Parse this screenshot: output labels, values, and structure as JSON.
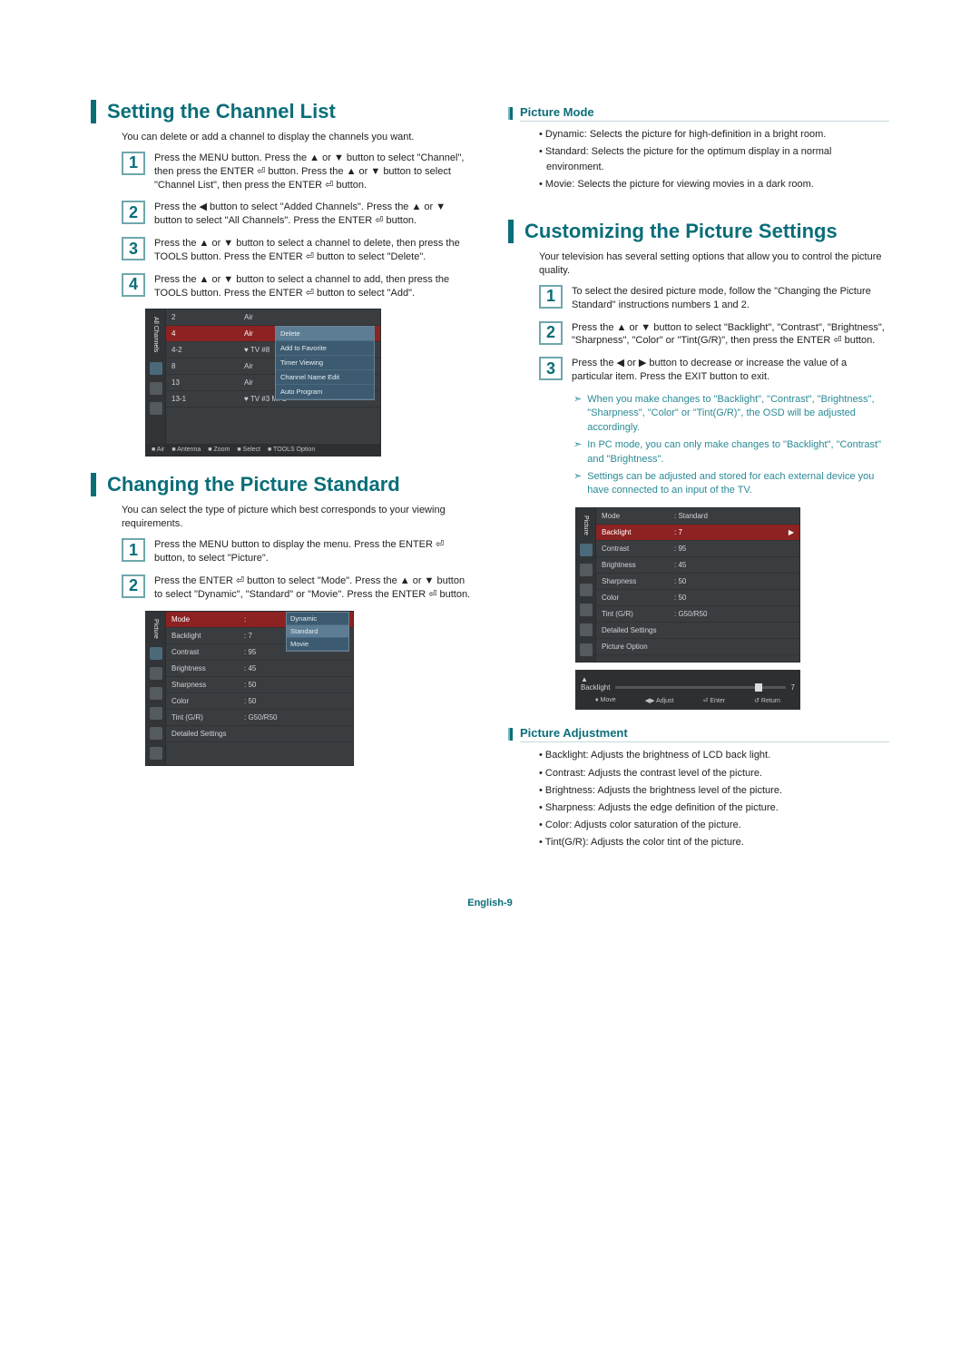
{
  "page_footer": "English-9",
  "left": {
    "section1": {
      "title": "Setting the Channel List",
      "intro": "You can delete or add a channel to display the channels you want.",
      "steps": [
        "Press the MENU button. Press the ▲ or ▼ button to select \"Channel\", then press the ENTER ⏎ button. Press the ▲ or ▼ button to select \"Channel List\", then press the ENTER ⏎ button.",
        "Press the ◀ button to select \"Added Channels\". Press the ▲ or ▼ button to select \"All Channels\". Press the ENTER ⏎ button.",
        "Press the ▲ or ▼ button to select a channel to delete, then press the TOOLS button. Press the ENTER ⏎ button to select \"Delete\".",
        "Press the ▲ or ▼ button to select a channel to add, then press the TOOLS button. Press the ENTER ⏎ button to select \"Add\"."
      ],
      "osd": {
        "side_label": "All Channels",
        "rows": [
          {
            "c1": "2",
            "c2": "Air"
          },
          {
            "c1": "4",
            "c2": "Air",
            "hl": true
          },
          {
            "c1": "4-2",
            "c2": "♥ TV #8"
          },
          {
            "c1": "8",
            "c2": "Air"
          },
          {
            "c1": "13",
            "c2": "Air"
          },
          {
            "c1": "13-1",
            "c2": "♥ TV #3   M. S"
          }
        ],
        "popup": [
          "Delete",
          "Add to Favorite",
          "Timer Viewing",
          "Channel Name Edit",
          "Auto Program"
        ],
        "foot": [
          "Air",
          "Antenna",
          "Zoom",
          "Select",
          "TOOLS Option"
        ]
      }
    },
    "section2": {
      "title": "Changing the Picture Standard",
      "intro": "You can select the type of picture which best corresponds to your viewing requirements.",
      "steps": [
        "Press the MENU button to display the menu. Press the ENTER ⏎ button, to select \"Picture\".",
        "Press the ENTER ⏎ button to select \"Mode\". Press the ▲ or ▼ button to select \"Dynamic\", \"Standard\" or \"Movie\". Press the ENTER ⏎ button."
      ],
      "osd": {
        "side_label": "Picture",
        "rows": [
          {
            "c1": "Mode",
            "c2": ":",
            "hl": true
          },
          {
            "c1": "Backlight",
            "c2": ": 7"
          },
          {
            "c1": "Contrast",
            "c2": ": 95"
          },
          {
            "c1": "Brightness",
            "c2": ": 45"
          },
          {
            "c1": "Sharpness",
            "c2": ": 50"
          },
          {
            "c1": "Color",
            "c2": ": 50"
          },
          {
            "c1": "Tint (G/R)",
            "c2": ": G50/R50"
          },
          {
            "c1": "Detailed Settings",
            "c2": ""
          }
        ],
        "dropdown": [
          "Dynamic",
          "Standard",
          "Movie"
        ]
      }
    }
  },
  "right": {
    "sub1": {
      "title": "Picture Mode",
      "bullets": [
        "Dynamic: Selects the picture for high-definition in a bright room.",
        "Standard: Selects the picture for the optimum display in a normal environment.",
        "Movie: Selects the picture for viewing movies in a dark room."
      ]
    },
    "section3": {
      "title": "Customizing the Picture Settings",
      "intro": "Your television has several setting options that allow you to control the picture quality.",
      "steps": [
        "To select the desired picture mode, follow the \"Changing the Picture Standard\" instructions numbers 1 and 2.",
        "Press the ▲ or ▼ button to select \"Backlight\", \"Contrast\", \"Brightness\", \"Sharpness\", \"Color\" or \"Tint(G/R)\", then press the ENTER ⏎ button.",
        "Press the ◀ or ▶ button to decrease or increase the value of a particular item. Press the EXIT button to exit."
      ],
      "notes": [
        "When you make changes to \"Backlight\", \"Contrast\", \"Brightness\", \"Sharpness\", \"Color\" or \"Tint(G/R)\", the OSD will be adjusted accordingly.",
        "In PC mode, you can only make changes to \"Backlight\", \"Contrast\" and \"Brightness\".",
        "Settings can be adjusted and stored for each external device you have connected to an input of the TV."
      ],
      "osd": {
        "side_label": "Picture",
        "rows": [
          {
            "c1": "Mode",
            "c2": ": Standard"
          },
          {
            "c1": "Backlight",
            "c2": ": 7",
            "hl": true,
            "arrow": "▶"
          },
          {
            "c1": "Contrast",
            "c2": ": 95"
          },
          {
            "c1": "Brightness",
            "c2": ": 45"
          },
          {
            "c1": "Sharpness",
            "c2": ": 50"
          },
          {
            "c1": "Color",
            "c2": ": 50"
          },
          {
            "c1": "Tint (G/R)",
            "c2": ": G50/R50"
          },
          {
            "c1": "Detailed Settings",
            "c2": ""
          },
          {
            "c1": "Picture Option",
            "c2": ""
          }
        ],
        "slider": {
          "label_up": "▲",
          "label": "Backlight",
          "value": "7",
          "pos_pct": 82
        },
        "foot2": [
          "♦ Move",
          "◀▶ Adjust",
          "⏎ Enter",
          "↺ Return"
        ]
      }
    },
    "sub2": {
      "title": "Picture Adjustment",
      "bullets": [
        "Backlight: Adjusts the brightness of LCD back light.",
        "Contrast: Adjusts the contrast level of the picture.",
        "Brightness: Adjusts the brightness level of the picture.",
        "Sharpness: Adjusts the edge definition of the picture.",
        "Color: Adjusts color saturation of the picture.",
        "Tint(G/R): Adjusts the color tint of the picture."
      ]
    }
  }
}
